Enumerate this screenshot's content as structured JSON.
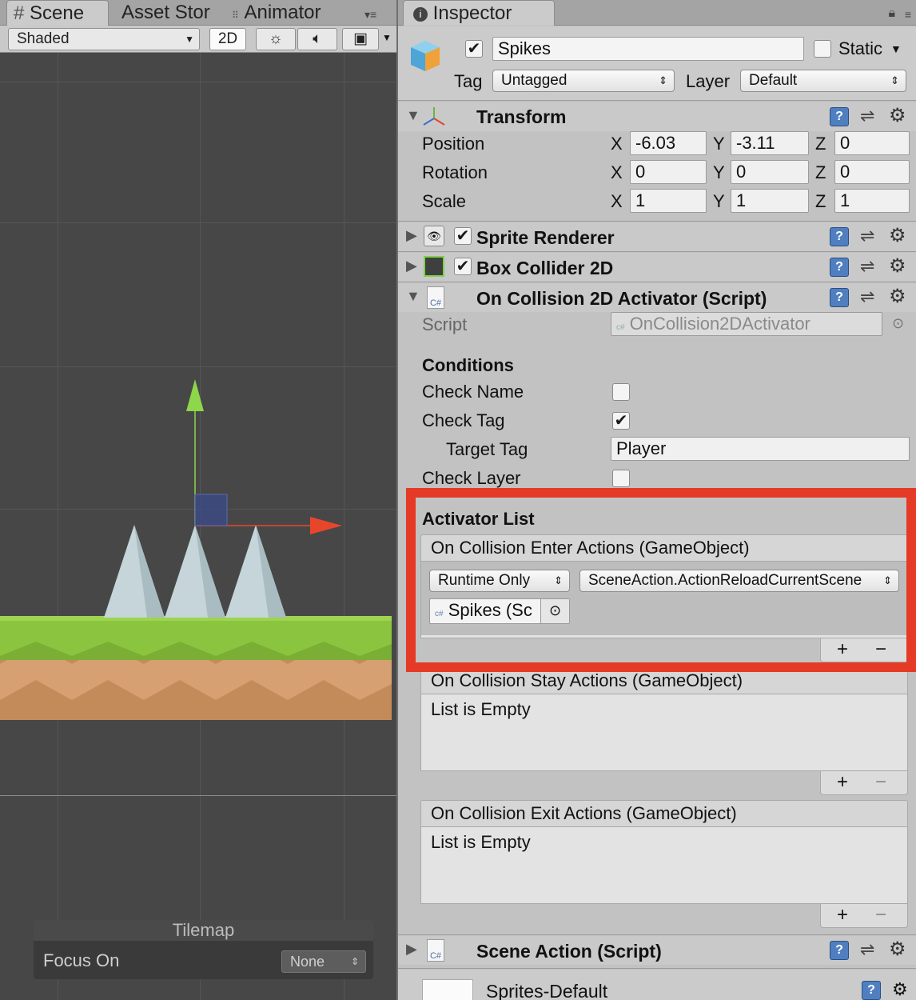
{
  "scene_panel": {
    "tabs": [
      {
        "label": "Scene",
        "icon": "grid-icon"
      },
      {
        "label": "Asset Stor"
      },
      {
        "label": "Animator",
        "icon": "drag-handle-icon"
      }
    ],
    "toolbar": {
      "shading_mode": "Shaded",
      "mode_2d": "2D"
    },
    "tilemap_overlay": {
      "title": "Tilemap",
      "focus_label": "Focus On",
      "focus_value": "None"
    }
  },
  "inspector": {
    "tab_label": "Inspector",
    "object": {
      "name": "Spikes",
      "active": true,
      "static_label": "Static",
      "static": false,
      "tag_label": "Tag",
      "tag_value": "Untagged",
      "layer_label": "Layer",
      "layer_value": "Default"
    },
    "transform": {
      "title": "Transform",
      "rows": [
        {
          "label": "Position",
          "x": "-6.03",
          "y": "-3.11",
          "z": "0"
        },
        {
          "label": "Rotation",
          "x": "0",
          "y": "0",
          "z": "0"
        },
        {
          "label": "Scale",
          "x": "1",
          "y": "1",
          "z": "1"
        }
      ],
      "axis_labels": {
        "x": "X",
        "y": "Y",
        "z": "Z"
      }
    },
    "sprite_renderer": {
      "title": "Sprite Renderer",
      "enabled": true
    },
    "box_collider": {
      "title": "Box Collider 2D",
      "enabled": true
    },
    "activator": {
      "title": "On Collision 2D Activator (Script)",
      "cs_badge": "C#",
      "script_label": "Script",
      "script_value": "OnCollision2DActivator",
      "conditions_header": "Conditions",
      "check_name_label": "Check Name",
      "check_name": false,
      "check_tag_label": "Check Tag",
      "check_tag": true,
      "target_tag_label": "Target Tag",
      "target_tag_value": "Player",
      "check_layer_label": "Check Layer",
      "check_layer": false,
      "activator_list_header": "Activator List",
      "enter_actions": {
        "title": "On Collision Enter Actions (GameObject)",
        "call_state": "Runtime Only",
        "function": "SceneAction.ActionReloadCurrentScene",
        "target_object": "Spikes (Sc"
      },
      "stay_actions": {
        "title": "On Collision Stay Actions (GameObject)",
        "empty_text": "List is Empty"
      },
      "exit_actions": {
        "title": "On Collision Exit Actions (GameObject)",
        "empty_text": "List is Empty"
      },
      "plus": "+",
      "minus": "−"
    },
    "scene_action": {
      "title": "Scene Action (Script)",
      "cs_badge": "C#"
    },
    "material": {
      "name": "Sprites-Default"
    }
  },
  "colors": {
    "highlight_frame": "#e53a26",
    "scene_background": "#474747",
    "gizmo_y_axis": "#8ed64a",
    "gizmo_x_axis": "#e8462a",
    "ground_grass": "#8cc63e",
    "ground_dirt": "#c98d5c",
    "spikes": "#c9d8dc"
  }
}
